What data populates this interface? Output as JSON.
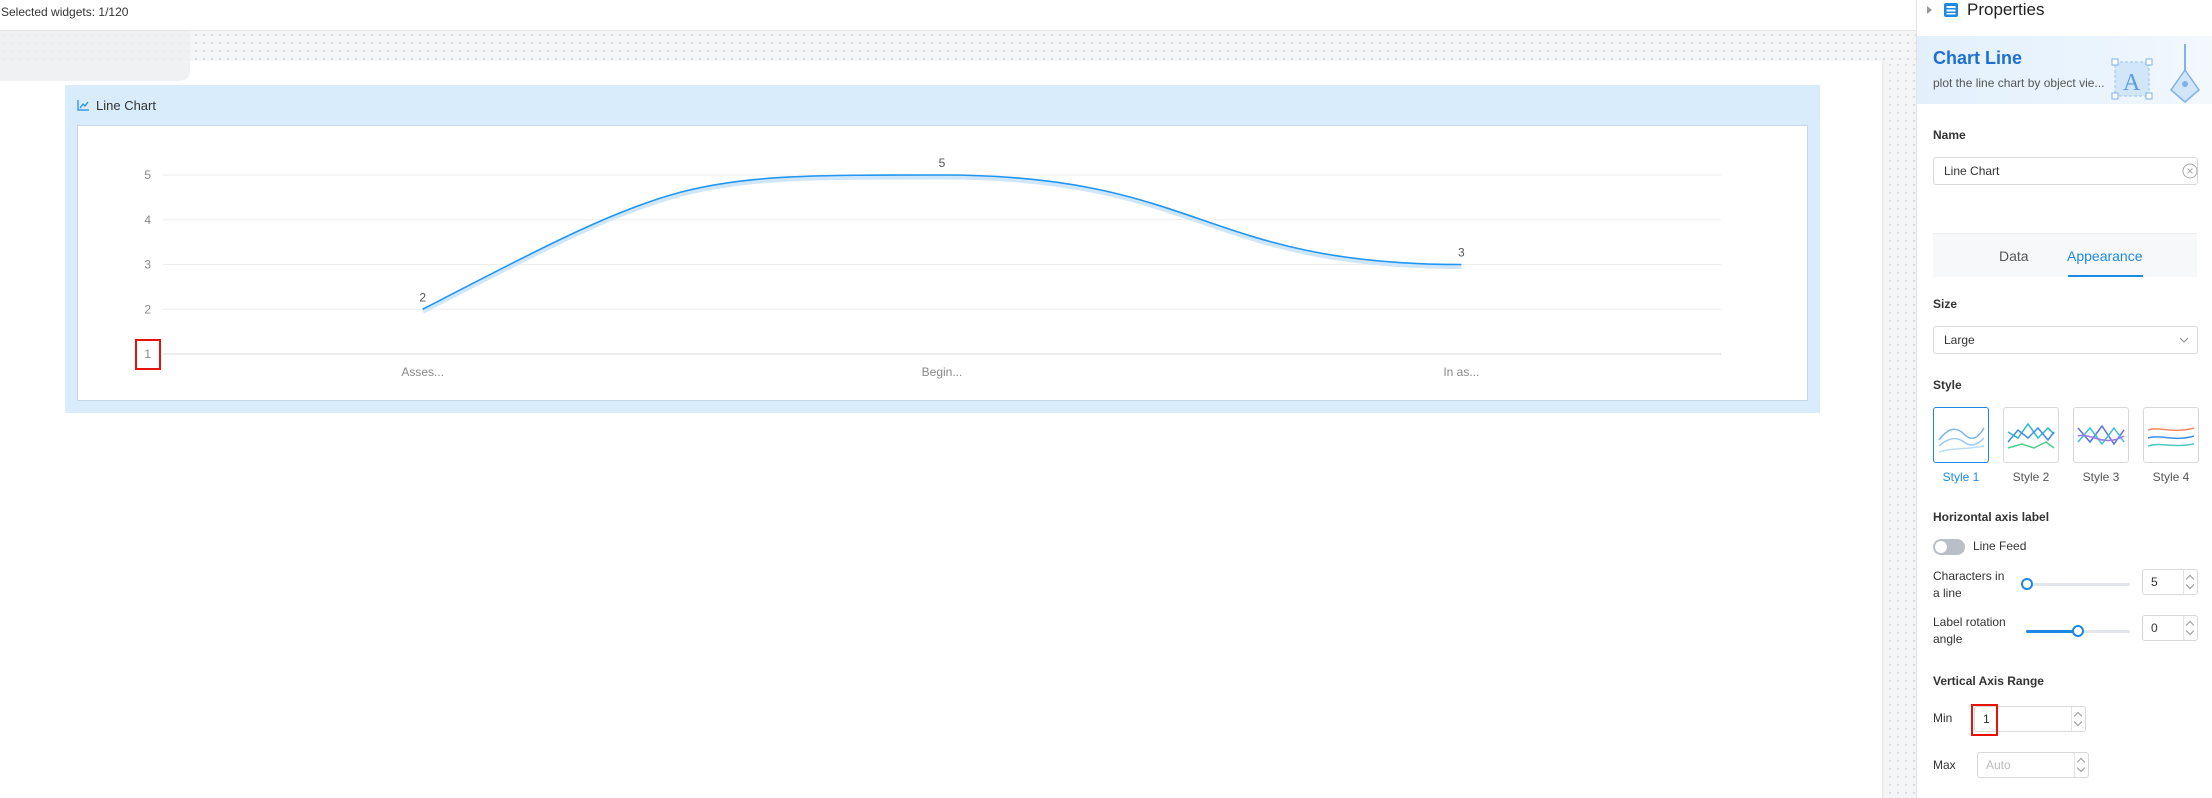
{
  "topbar": {
    "selected_widgets": "Selected widgets: 1/120"
  },
  "widget": {
    "title": "Line Chart"
  },
  "chart_data": {
    "type": "line",
    "categories": [
      "Asses...",
      "Begin...",
      "In as..."
    ],
    "series": [
      {
        "values": [
          2,
          5,
          3
        ]
      }
    ],
    "y_ticks": [
      "1",
      "2",
      "3",
      "4",
      "5"
    ],
    "ylim": [
      1,
      5
    ],
    "title": "",
    "xlabel": "",
    "ylabel": "",
    "grid": true,
    "smooth": true,
    "line_color": "#2196f3",
    "data_labels": true
  },
  "panel": {
    "title": "Properties",
    "banner": {
      "title": "Chart Line",
      "description": "plot the line chart by object vie..."
    },
    "name": {
      "label": "Name",
      "value": "Line Chart"
    },
    "tabs": [
      {
        "label": "Data"
      },
      {
        "label": "Appearance",
        "active": true
      }
    ],
    "size": {
      "label": "Size",
      "value": "Large"
    },
    "style": {
      "label": "Style",
      "options": [
        {
          "label": "Style 1",
          "active": true
        },
        {
          "label": "Style 2"
        },
        {
          "label": "Style 3"
        },
        {
          "label": "Style 4"
        }
      ]
    },
    "horizontal_axis": {
      "label": "Horizontal axis label",
      "line_feed": {
        "label": "Line Feed",
        "enabled": false
      },
      "chars_in_line": {
        "label": "Characters in a line",
        "value": "5",
        "fraction": 0.0
      },
      "rotation": {
        "label": "Label rotation angle",
        "value": "0",
        "fraction": 0.5
      }
    },
    "vertical_axis": {
      "label": "Vertical Axis Range",
      "min": {
        "label": "Min",
        "value": "1"
      },
      "max": {
        "label": "Max",
        "placeholder": "Auto"
      }
    }
  },
  "colors": {
    "accent": "#1e88e5",
    "highlight": "#e8120c",
    "widget_bg": "#d9ecfb"
  }
}
